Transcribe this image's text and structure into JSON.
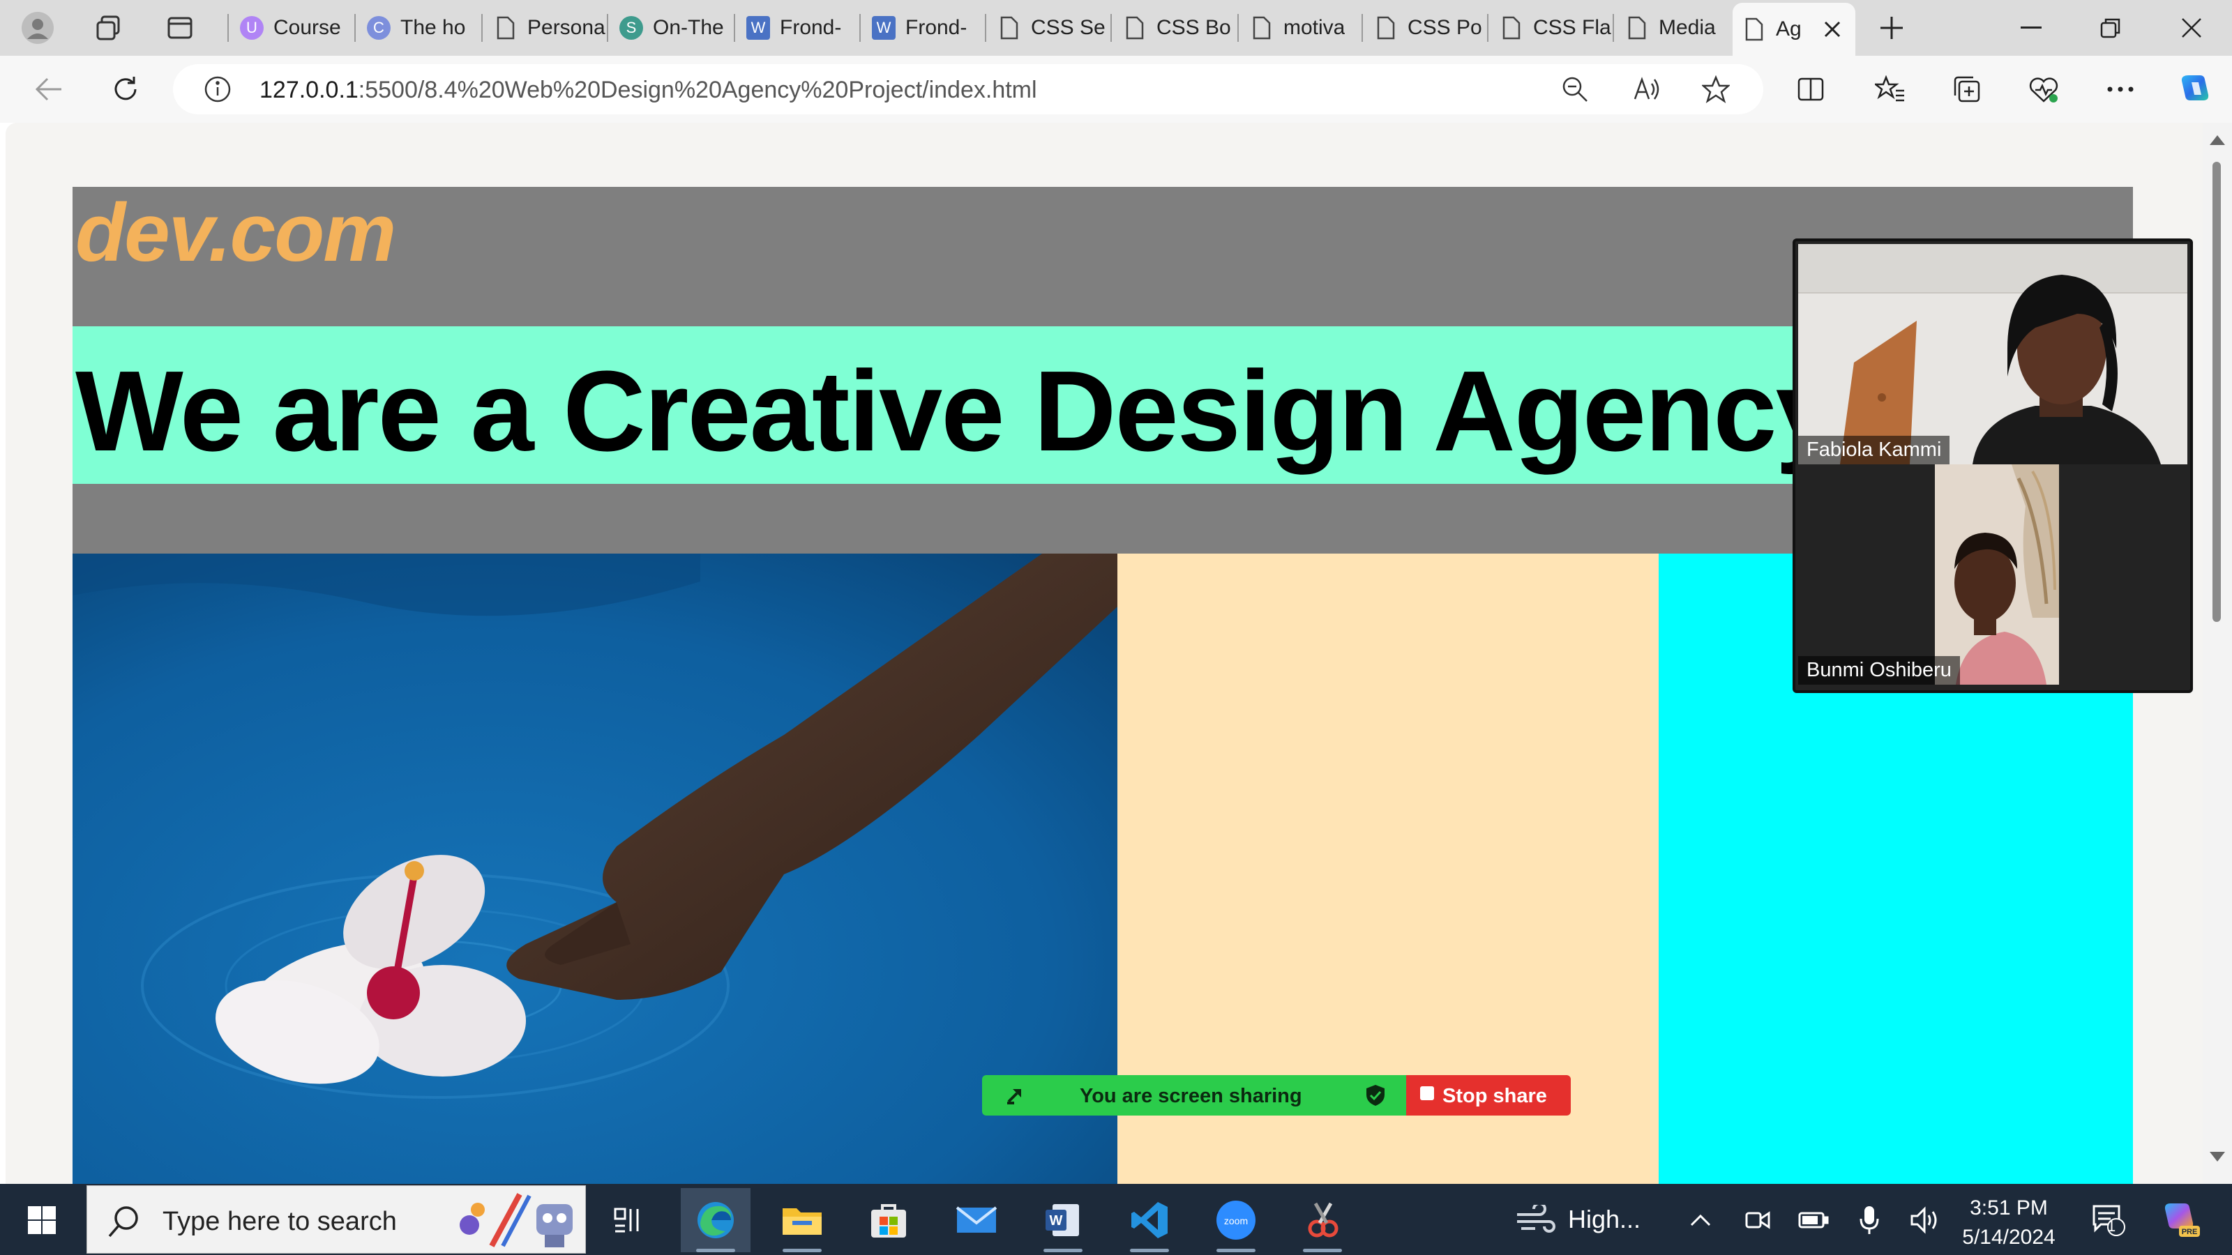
{
  "browser": {
    "tabs": [
      {
        "label": "Course",
        "favicon": "course-icon"
      },
      {
        "label": "The ho",
        "favicon": "copilot-c-icon"
      },
      {
        "label": "Persona",
        "favicon": "page-icon"
      },
      {
        "label": "On-The",
        "favicon": "sharepoint-icon"
      },
      {
        "label": "Frond-",
        "favicon": "word-doc-icon"
      },
      {
        "label": "Frond-",
        "favicon": "word-doc-icon"
      },
      {
        "label": "CSS Se",
        "favicon": "page-icon"
      },
      {
        "label": "CSS Bo",
        "favicon": "page-icon"
      },
      {
        "label": "motiva",
        "favicon": "page-icon"
      },
      {
        "label": "CSS Po",
        "favicon": "page-icon"
      },
      {
        "label": "CSS Fla",
        "favicon": "page-icon"
      },
      {
        "label": "Media",
        "favicon": "page-icon"
      },
      {
        "label": "Ag",
        "favicon": "page-icon",
        "active": true
      }
    ],
    "address": {
      "host": "127.0.0.1",
      "path": ":5500/8.4%20Web%20Design%20Agency%20Project/index.html"
    }
  },
  "page": {
    "logo": "dev.com",
    "headline": "We are a Creative Design Agency",
    "colors": {
      "hero_bg": "#7f7f7f",
      "logo": "#f4b25b",
      "headline_band": "#7fffd4",
      "column_2": "#ffe4b5",
      "column_3": "#00ffff"
    }
  },
  "zoom": {
    "participants": [
      {
        "name": "Fabiola Kammi"
      },
      {
        "name": "Bunmi Oshiberu"
      }
    ],
    "share_status": "You are screen sharing",
    "stop_label": "Stop share"
  },
  "taskbar": {
    "search_placeholder": "Type here to search",
    "weather": "High...",
    "time": "3:51 PM",
    "date": "5/14/2024",
    "notification_count": "1"
  }
}
